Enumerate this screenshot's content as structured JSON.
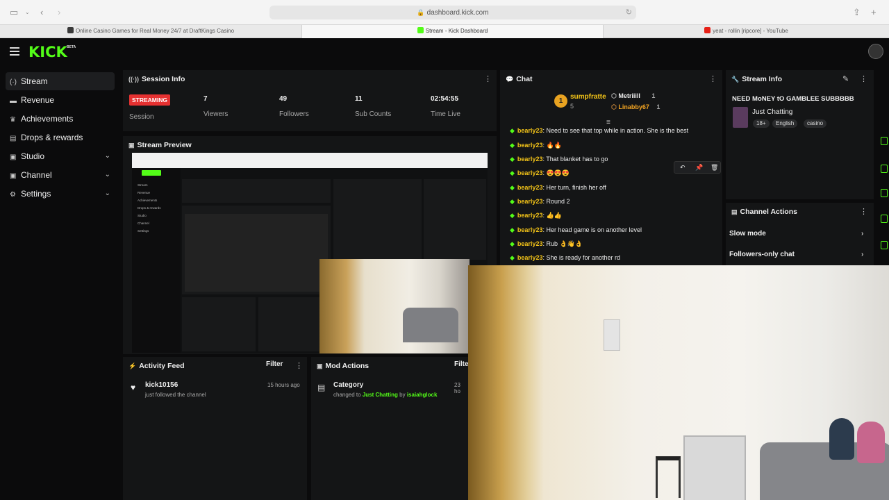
{
  "browser": {
    "url": "dashboard.kick.com",
    "tabs": [
      {
        "label": "Online Casino Games for Real Money 24/7 at DraftKings Casino",
        "fav_color": "#3a3a3a"
      },
      {
        "label": "Stream - Kick Dashboard",
        "fav_color": "#53fc18"
      },
      {
        "label": "yeat - rollin [ripcore] - YouTube",
        "fav_color": "#e62117"
      }
    ]
  },
  "header": {
    "logo": "KICK",
    "logo_sup": "BETA"
  },
  "sidebar": {
    "items": [
      {
        "label": "Stream",
        "icon": "stream-icon",
        "glyph": "((·))"
      },
      {
        "label": "Revenue",
        "icon": "money-icon",
        "glyph": "▬"
      },
      {
        "label": "Achievements",
        "icon": "trophy-icon",
        "glyph": "🏆"
      },
      {
        "label": "Drops & rewards",
        "icon": "gift-icon",
        "glyph": "🎁"
      },
      {
        "label": "Studio",
        "icon": "studio-icon",
        "glyph": "▣"
      },
      {
        "label": "Channel",
        "icon": "channel-icon",
        "glyph": "▣"
      },
      {
        "label": "Settings",
        "icon": "gear-icon",
        "glyph": "⚙"
      }
    ]
  },
  "session": {
    "title": "Session Info",
    "status": "STREAMING",
    "status_label": "Session",
    "viewers": "7",
    "viewers_label": "Viewers",
    "followers": "49",
    "followers_label": "Followers",
    "subs": "11",
    "subs_label": "Sub Counts",
    "time_live": "02:54:55",
    "time_label": "Time Live"
  },
  "preview": {
    "title": "Stream Preview"
  },
  "chat": {
    "title": "Chat",
    "gifters": [
      {
        "name": "sumpfratte",
        "count": "5"
      },
      {
        "name": "Metriiill",
        "count": "1"
      },
      {
        "name": "Linabby67",
        "count": "1"
      }
    ],
    "messages": [
      {
        "user": "bearly23",
        "text": ": Need to see that top while in action. She is the best"
      },
      {
        "user": "bearly23",
        "text": ": 🔥🔥"
      },
      {
        "user": "bearly23",
        "text": ": That blanket has to go"
      },
      {
        "user": "bearly23",
        "text": ": 😍😍😍"
      },
      {
        "user": "bearly23",
        "text": ": Her turn, finish her off"
      },
      {
        "user": "bearly23",
        "text": ": Round 2"
      },
      {
        "user": "bearly23",
        "text": ": 👍👍"
      },
      {
        "user": "bearly23",
        "text": ": Her head game is on another level"
      },
      {
        "user": "bearly23",
        "text": ": Rub 👌👋👌"
      },
      {
        "user": "bearly23",
        "text": ": She is ready for another rd"
      }
    ]
  },
  "stream_info": {
    "title": "Stream Info",
    "stream_title": "NEED MoNEY tO GAMBLEE SUBBBBB",
    "category": "Just Chatting",
    "tags": [
      "18+",
      "English",
      "casino"
    ]
  },
  "channel_actions": {
    "title": "Channel Actions",
    "items": [
      "Slow mode",
      "Followers-only chat"
    ]
  },
  "activity": {
    "title": "Activity Feed",
    "filter": "Filter",
    "items": [
      {
        "user": "kick10156",
        "desc": "just followed the channel",
        "time": "15 hours ago"
      }
    ]
  },
  "mod_actions": {
    "title": "Mod Actions",
    "filter": "Filte",
    "items": [
      {
        "title": "Category",
        "prefix": "changed to ",
        "value": "Just Chatting",
        "by": " by ",
        "mod": "isaiahglock",
        "time": "23 ho"
      }
    ]
  },
  "colors": {
    "accent": "#53fc18",
    "live": "#e63131",
    "username": "#f5c518"
  }
}
